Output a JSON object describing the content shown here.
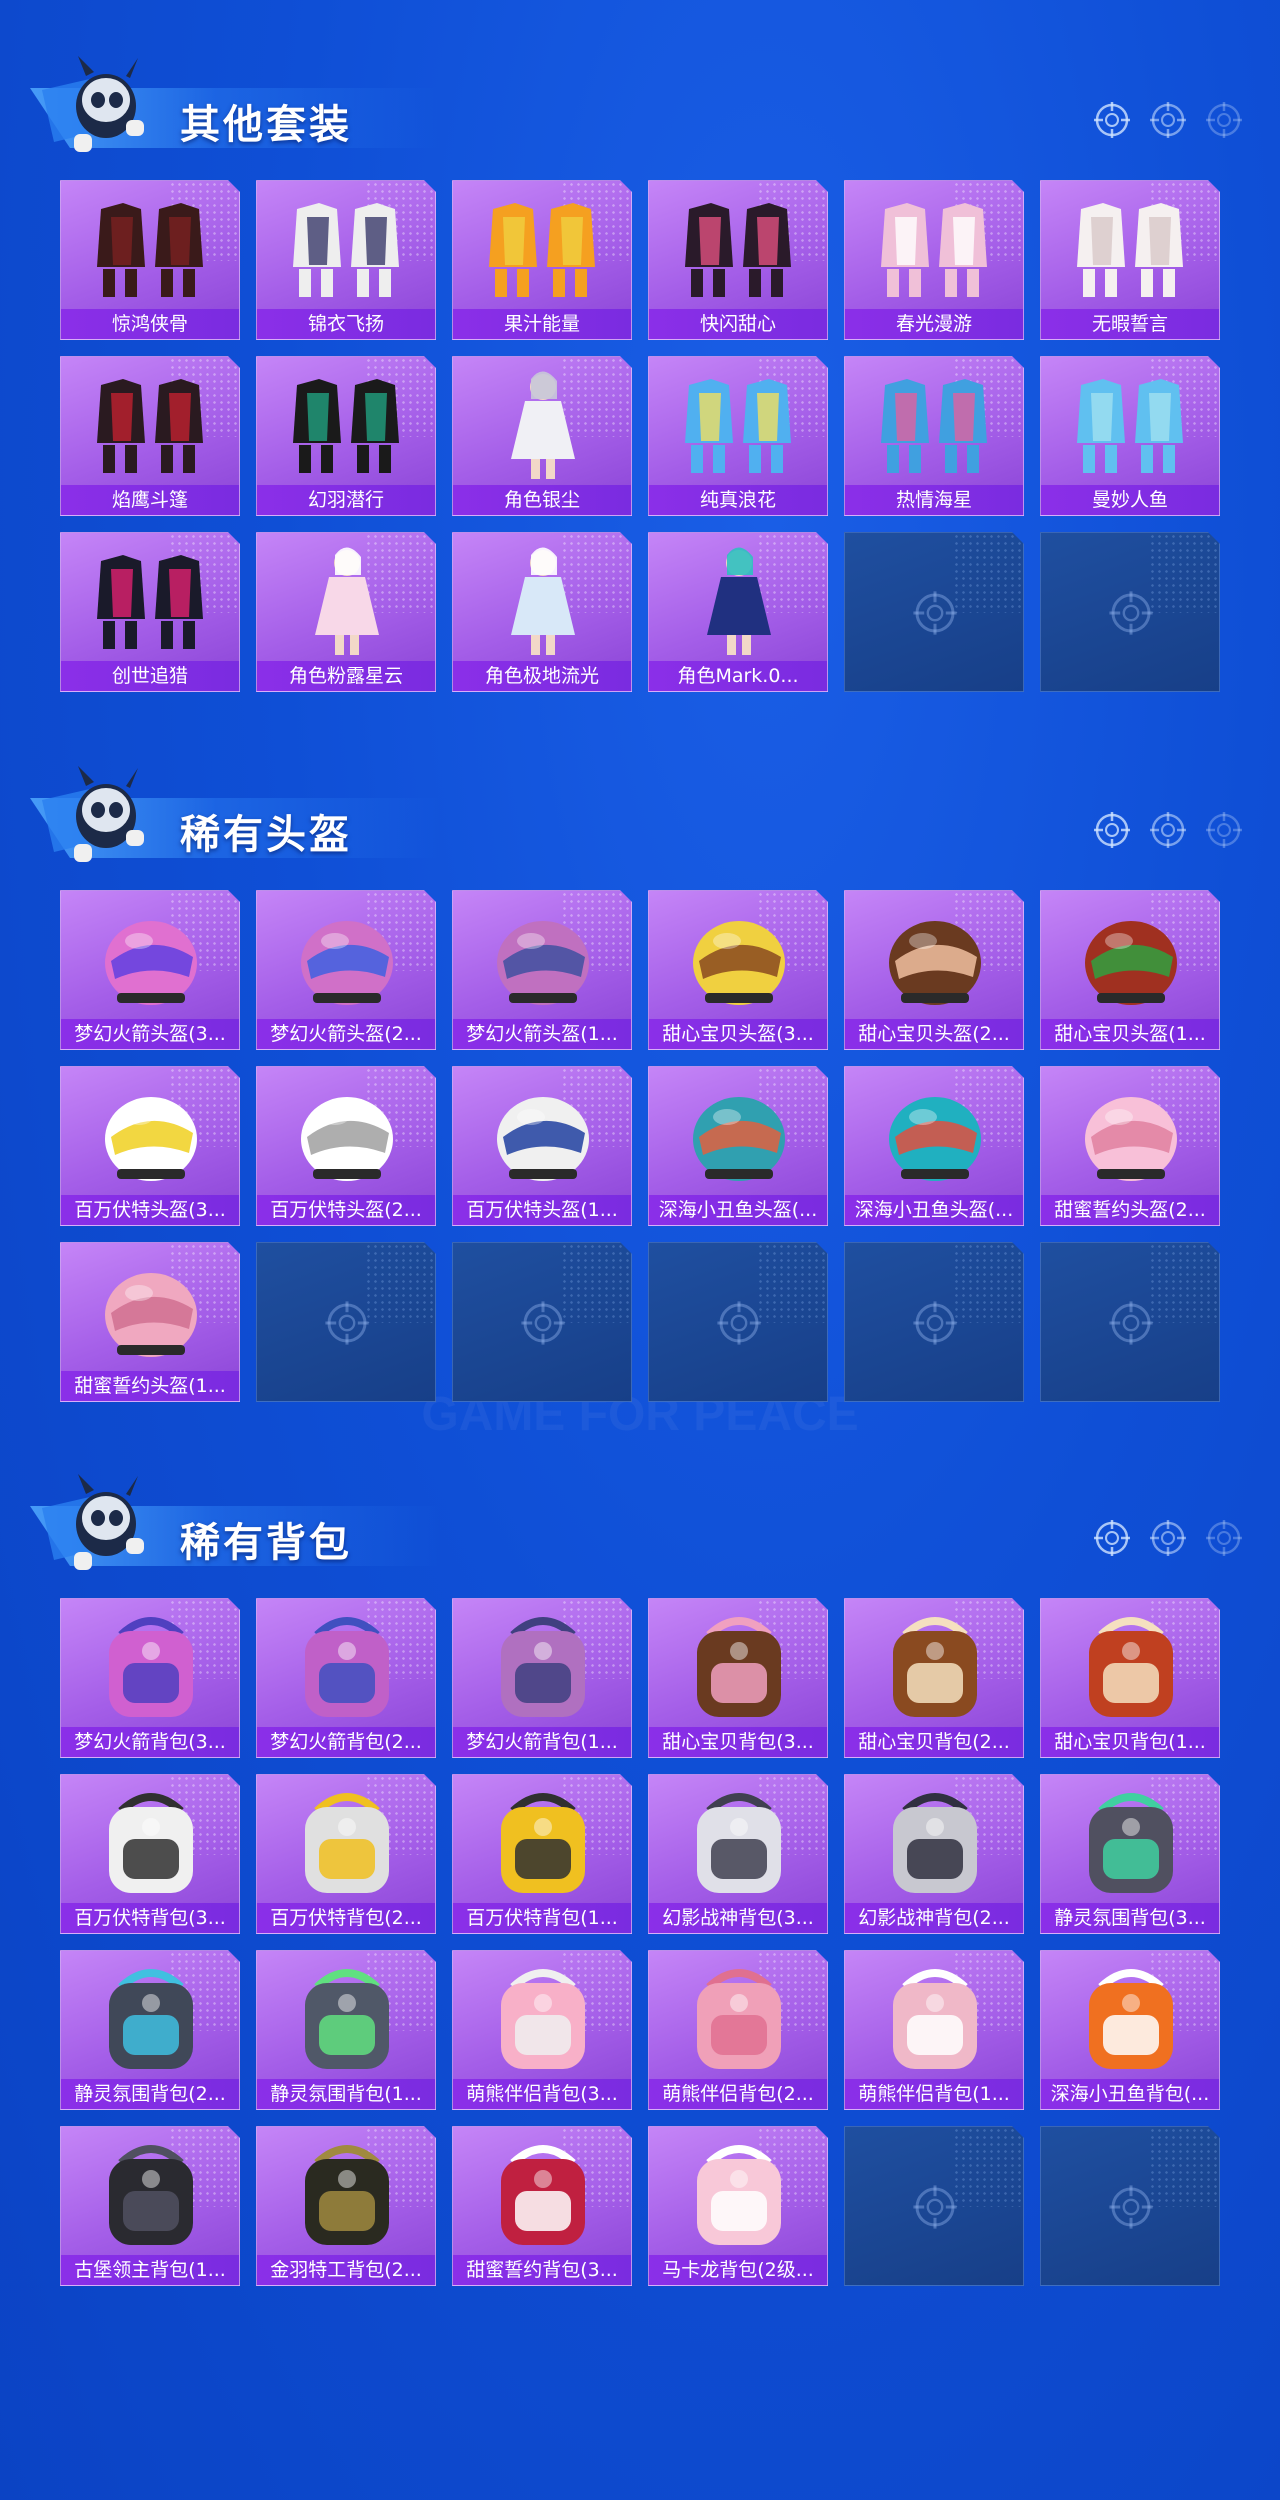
{
  "colors": {
    "background": "#0f4fd6",
    "card": "#a45ee8",
    "label": "#8b2fe8",
    "empty_card": "#1f4fa0"
  },
  "sections": [
    {
      "title": "其他套装",
      "items": [
        {
          "label": "惊鸿侠骨",
          "icon": "outfit-icon",
          "c1": "#3a1a1a",
          "c2": "#7a2020"
        },
        {
          "label": "锦衣飞扬",
          "icon": "outfit-icon",
          "c1": "#eeeeee",
          "c2": "#3a3a6a"
        },
        {
          "label": "果汁能量",
          "icon": "outfit-icon",
          "c1": "#f5a020",
          "c2": "#f0d040"
        },
        {
          "label": "快闪甜心",
          "icon": "outfit-icon",
          "c1": "#2a1a2a",
          "c2": "#e05080"
        },
        {
          "label": "春光漫游",
          "icon": "outfit-icon",
          "c1": "#f0c0d8",
          "c2": "#ffffff"
        },
        {
          "label": "无暇誓言",
          "icon": "outfit-icon",
          "c1": "#f5f0f0",
          "c2": "#d8c8c8"
        },
        {
          "label": "焰鹰斗篷",
          "icon": "outfit-icon",
          "c1": "#2a1a20",
          "c2": "#c02030"
        },
        {
          "label": "幻羽潜行",
          "icon": "outfit-icon",
          "c1": "#1a1a1a",
          "c2": "#20a080"
        },
        {
          "label": "角色银尘",
          "icon": "character-icon",
          "c1": "#f0f0f5",
          "c2": "#c8c8d8"
        },
        {
          "label": "纯真浪花",
          "icon": "outfit-icon",
          "c1": "#50b0f0",
          "c2": "#f0e060"
        },
        {
          "label": "热情海星",
          "icon": "outfit-icon",
          "c1": "#40a0e0",
          "c2": "#e060a0"
        },
        {
          "label": "曼妙人鱼",
          "icon": "outfit-icon",
          "c1": "#60c0f0",
          "c2": "#a0e0f0"
        },
        {
          "label": "创世追猎",
          "icon": "outfit-icon",
          "c1": "#1a1a2a",
          "c2": "#e02070"
        },
        {
          "label": "角色粉露星云",
          "icon": "character-icon",
          "c1": "#f8d8e8",
          "c2": "#ffffff"
        },
        {
          "label": "角色极地流光",
          "icon": "character-icon",
          "c1": "#d8e8f8",
          "c2": "#ffffff"
        },
        {
          "label": "角色Mark.0...",
          "icon": "character-icon",
          "c1": "#203080",
          "c2": "#30c0c0"
        }
      ],
      "empty_slots": 2
    },
    {
      "title": "稀有头盔",
      "items": [
        {
          "label": "梦幻火箭头盔(3...",
          "icon": "helmet-icon",
          "c1": "#e070d0",
          "c2": "#6040e0"
        },
        {
          "label": "梦幻火箭头盔(2...",
          "icon": "helmet-icon",
          "c1": "#d070c8",
          "c2": "#4060e0"
        },
        {
          "label": "梦幻火箭头盔(1...",
          "icon": "helmet-icon",
          "c1": "#c070c0",
          "c2": "#4050a0"
        },
        {
          "label": "甜心宝贝头盔(3...",
          "icon": "helmet-icon",
          "c1": "#f0d040",
          "c2": "#8a4a20"
        },
        {
          "label": "甜心宝贝头盔(2...",
          "icon": "helmet-icon",
          "c1": "#6a3a20",
          "c2": "#f0c0a0"
        },
        {
          "label": "甜心宝贝头盔(1...",
          "icon": "helmet-icon",
          "c1": "#a03020",
          "c2": "#30a040"
        },
        {
          "label": "百万伏特头盔(3...",
          "icon": "helmet-icon",
          "c1": "#ffffff",
          "c2": "#f0d020"
        },
        {
          "label": "百万伏特头盔(2...",
          "icon": "helmet-icon",
          "c1": "#ffffff",
          "c2": "#a0a0a0"
        },
        {
          "label": "百万伏特头盔(1...",
          "icon": "helmet-icon",
          "c1": "#f0f0f0",
          "c2": "#2040a0"
        },
        {
          "label": "深海小丑鱼头盔(...",
          "icon": "helmet-icon",
          "c1": "#30a0b0",
          "c2": "#e06040"
        },
        {
          "label": "深海小丑鱼头盔(...",
          "icon": "helmet-icon",
          "c1": "#20b0c0",
          "c2": "#e05040"
        },
        {
          "label": "甜蜜誓约头盔(2...",
          "icon": "helmet-icon",
          "c1": "#f8c0d8",
          "c2": "#e080a0"
        },
        {
          "label": "甜蜜誓约头盔(1...",
          "icon": "helmet-icon",
          "c1": "#f0a8c0",
          "c2": "#d07090"
        }
      ],
      "empty_slots": 5
    },
    {
      "title": "稀有背包",
      "items": [
        {
          "label": "梦幻火箭背包(3...",
          "icon": "backpack-icon",
          "c1": "#d060d0",
          "c2": "#5040c0"
        },
        {
          "label": "梦幻火箭背包(2...",
          "icon": "backpack-icon",
          "c1": "#c060c8",
          "c2": "#4050c0"
        },
        {
          "label": "梦幻火箭背包(1...",
          "icon": "backpack-icon",
          "c1": "#b070c0",
          "c2": "#404080"
        },
        {
          "label": "甜心宝贝背包(3...",
          "icon": "backpack-icon",
          "c1": "#6a3a20",
          "c2": "#f0a0c0"
        },
        {
          "label": "甜心宝贝背包(2...",
          "icon": "backpack-icon",
          "c1": "#8a4a20",
          "c2": "#f5e0c0"
        },
        {
          "label": "甜心宝贝背包(1...",
          "icon": "backpack-icon",
          "c1": "#c04020",
          "c2": "#f5e0c0"
        },
        {
          "label": "百万伏特背包(3...",
          "icon": "backpack-icon",
          "c1": "#f0f0f0",
          "c2": "#303030"
        },
        {
          "label": "百万伏特背包(2...",
          "icon": "backpack-icon",
          "c1": "#e0e0e0",
          "c2": "#f0c020"
        },
        {
          "label": "百万伏特背包(1...",
          "icon": "backpack-icon",
          "c1": "#f0c020",
          "c2": "#303030"
        },
        {
          "label": "幻影战神背包(3...",
          "icon": "backpack-icon",
          "c1": "#e0e0e8",
          "c2": "#404050"
        },
        {
          "label": "幻影战神背包(2...",
          "icon": "backpack-icon",
          "c1": "#c8c8d0",
          "c2": "#303040"
        },
        {
          "label": "静灵氛围背包(3...",
          "icon": "backpack-icon",
          "c1": "#505060",
          "c2": "#40d0a0"
        },
        {
          "label": "静灵氛围背包(2...",
          "icon": "backpack-icon",
          "c1": "#404858",
          "c2": "#40c0e0"
        },
        {
          "label": "静灵氛围背包(1...",
          "icon": "backpack-icon",
          "c1": "#505868",
          "c2": "#60e080"
        },
        {
          "label": "萌熊伴侣背包(3...",
          "icon": "backpack-icon",
          "c1": "#f8b0c8",
          "c2": "#f0f0f0"
        },
        {
          "label": "萌熊伴侣背包(2...",
          "icon": "backpack-icon",
          "c1": "#f0a0b8",
          "c2": "#e07090"
        },
        {
          "label": "萌熊伴侣背包(1...",
          "icon": "backpack-icon",
          "c1": "#f0b8c8",
          "c2": "#ffffff"
        },
        {
          "label": "深海小丑鱼背包(...",
          "icon": "backpack-icon",
          "c1": "#f07020",
          "c2": "#ffffff"
        },
        {
          "label": "古堡领主背包(1...",
          "icon": "backpack-icon",
          "c1": "#2a2a30",
          "c2": "#505060"
        },
        {
          "label": "金羽特工背包(2...",
          "icon": "backpack-icon",
          "c1": "#2a2a20",
          "c2": "#a08a40"
        },
        {
          "label": "甜蜜誓约背包(3...",
          "icon": "backpack-icon",
          "c1": "#c02040",
          "c2": "#ffffff"
        },
        {
          "label": "马卡龙背包(2级...",
          "icon": "backpack-icon",
          "c1": "#f8c8d8",
          "c2": "#ffffff"
        }
      ],
      "empty_slots": 2
    }
  ]
}
